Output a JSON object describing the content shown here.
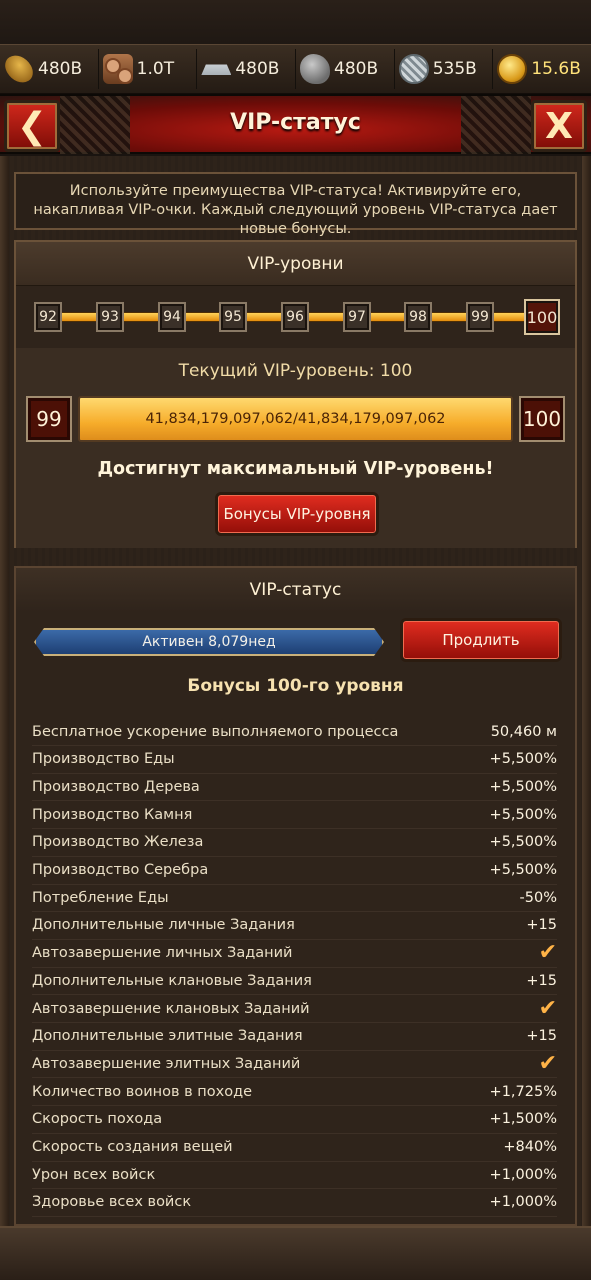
{
  "resources": [
    {
      "name": "food",
      "icon": "wheat-icon",
      "value": "480B"
    },
    {
      "name": "wood",
      "icon": "wood-logs-icon",
      "value": "1.0T"
    },
    {
      "name": "iron",
      "icon": "iron-ingot-icon",
      "value": "480B"
    },
    {
      "name": "stone",
      "icon": "stone-icon",
      "value": "480B"
    },
    {
      "name": "silver",
      "icon": "silver-icon",
      "value": "535B"
    },
    {
      "name": "gold",
      "icon": "gold-coin-icon",
      "value": "15.6B"
    }
  ],
  "header": {
    "title": "VIP-статус",
    "back_glyph": "❮",
    "close_glyph": "X"
  },
  "intro_text": "Используйте преимущества VIP-статуса! Активируйте его, накапливая VIP-очки. Каждый следующий уровень VIP-статуса дает новые бонусы.",
  "vip_levels": {
    "title": "VIP-уровни",
    "levels": [
      "92",
      "93",
      "94",
      "95",
      "96",
      "97",
      "98",
      "99",
      "100"
    ],
    "current_index": 8,
    "current_label": "Текущий VIP-уровень: 100",
    "progress": {
      "from": "99",
      "to": "100",
      "text": "41,834,179,097,062/41,834,179,097,062",
      "fraction": 1.0
    },
    "max_message": "Достигнут максимальный VIP-уровень!",
    "bonus_button": "Бонусы VIP-уровня"
  },
  "vip_status": {
    "title": "VIP-статус",
    "active_text": "Активен 8,079нед",
    "extend_button": "Продлить",
    "bonus_title": "Бонусы 100-го уровня",
    "bonuses": [
      {
        "name": "Бесплатное ускорение выполняемого процесса",
        "value": "50,460 м"
      },
      {
        "name": "Производство Еды",
        "value": "+5,500%"
      },
      {
        "name": "Производство Дерева",
        "value": "+5,500%"
      },
      {
        "name": "Производство Камня",
        "value": "+5,500%"
      },
      {
        "name": "Производство Железа",
        "value": "+5,500%"
      },
      {
        "name": "Производство Серебра",
        "value": "+5,500%"
      },
      {
        "name": "Потребление Еды",
        "value": "-50%"
      },
      {
        "name": "Дополнительные личные Задания",
        "value": "+15"
      },
      {
        "name": "Автозавершение личных Заданий",
        "value": "✔"
      },
      {
        "name": "Дополнительные клановые Задания",
        "value": "+15"
      },
      {
        "name": "Автозавершение клановых Заданий",
        "value": "✔"
      },
      {
        "name": "Дополнительные элитные Задания",
        "value": "+15"
      },
      {
        "name": "Автозавершение элитных Заданий",
        "value": "✔"
      },
      {
        "name": "Количество воинов в походе",
        "value": "+1,725%"
      },
      {
        "name": "Скорость похода",
        "value": "+1,500%"
      },
      {
        "name": "Скорость создания вещей",
        "value": "+840%"
      },
      {
        "name": "Урон всех войск",
        "value": "+1,000%"
      },
      {
        "name": "Здоровье всех войск",
        "value": "+1,000%"
      }
    ]
  }
}
